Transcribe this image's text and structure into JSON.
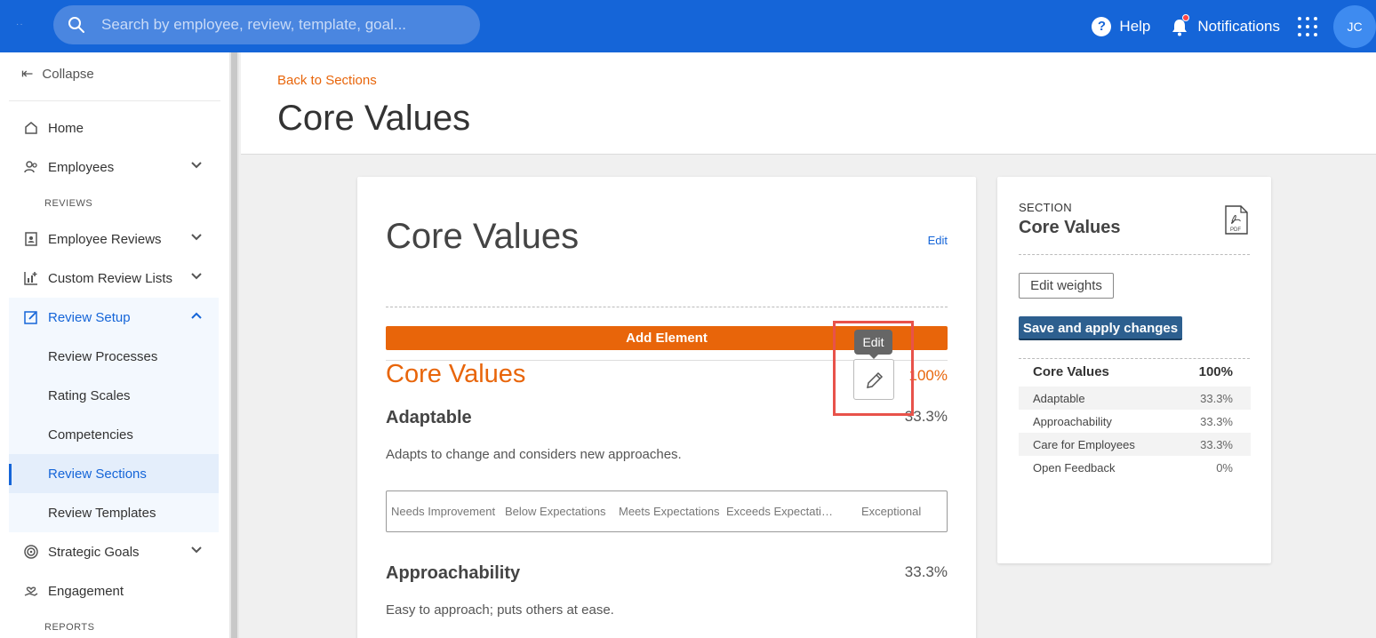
{
  "topbar": {
    "search_placeholder": "Search by employee, review, template, goal...",
    "help_label": "Help",
    "notifications_label": "Notifications",
    "avatar_initials": "JC",
    "accent_color": "#1565d8"
  },
  "sidebar": {
    "collapse_label": "Collapse",
    "home": "Home",
    "employees": "Employees",
    "section_reviews": "REVIEWS",
    "employee_reviews": "Employee Reviews",
    "custom_review_lists": "Custom Review Lists",
    "review_setup": "Review Setup",
    "sub_items": [
      "Review Processes",
      "Rating Scales",
      "Competencies",
      "Review Sections",
      "Review Templates"
    ],
    "active_sub_item": "Review Sections",
    "strategic_goals": "Strategic Goals",
    "engagement": "Engagement",
    "section_reports": "REPORTS"
  },
  "header": {
    "back_link": "Back to Sections",
    "title": "Core Values"
  },
  "card": {
    "title": "Core Values",
    "edit_label": "Edit",
    "add_element_label": "Add Element",
    "section_name": "Core Values",
    "section_pct": "100%",
    "elements": [
      {
        "name": "Adaptable",
        "pct": "33.3%",
        "description": "Adapts to change and considers new approaches."
      },
      {
        "name": "Approachability",
        "pct": "33.3%",
        "description": "Easy to approach; puts others at ease."
      }
    ],
    "scale_labels": [
      "Needs Improvement",
      "Below Expectations",
      "Meets Expectations",
      "Exceeds Expectati…",
      "Exceptional"
    ],
    "tooltip_label": "Edit",
    "orange_color": "#e8650a"
  },
  "panel": {
    "label": "SECTION",
    "title": "Core Values",
    "edit_weights_label": "Edit weights",
    "save_label": "Save and apply changes",
    "total_name": "Core Values",
    "total_pct": "100%",
    "rows": [
      {
        "name": "Adaptable",
        "pct": "33.3%"
      },
      {
        "name": "Approachability",
        "pct": "33.3%"
      },
      {
        "name": "Care for Employees",
        "pct": "33.3%"
      },
      {
        "name": "Open Feedback",
        "pct": "0%"
      }
    ]
  }
}
